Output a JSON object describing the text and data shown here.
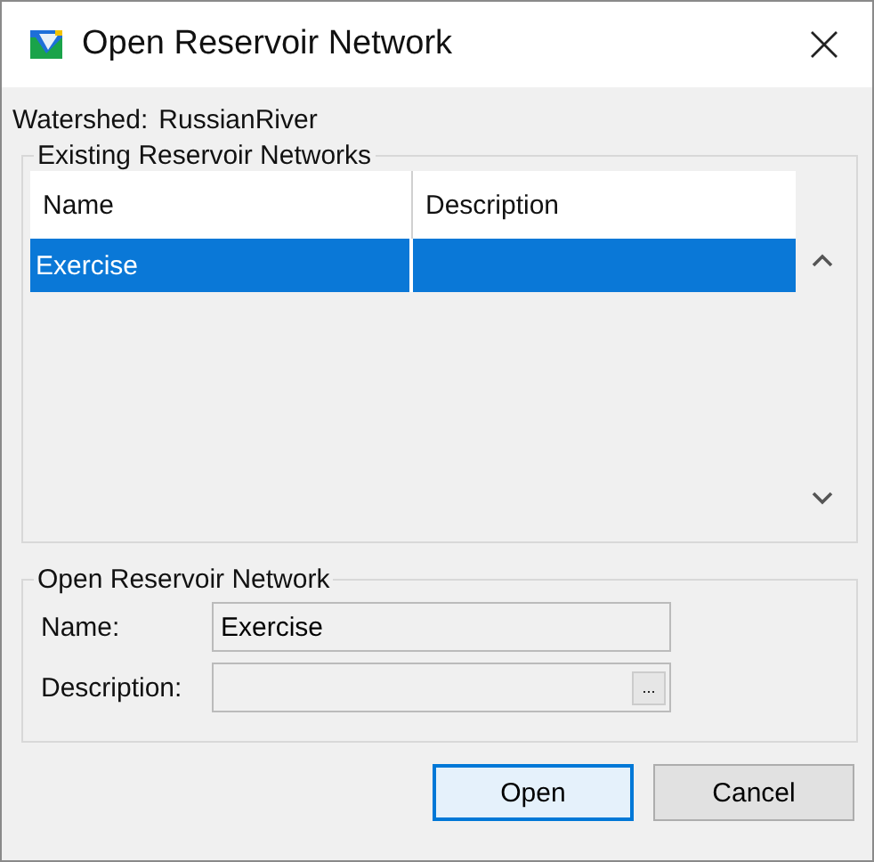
{
  "window": {
    "title": "Open Reservoir Network"
  },
  "watershed": {
    "label": "Watershed:",
    "value": "RussianRiver"
  },
  "networks": {
    "title": "Existing Reservoir Networks",
    "columns": [
      "Name",
      "Description"
    ],
    "rows": [
      {
        "name": "Exercise",
        "description": "",
        "selected": true
      }
    ]
  },
  "open_group": {
    "title": "Open Reservoir Network",
    "name_label": "Name:",
    "name_value": "Exercise",
    "description_label": "Description:",
    "browse": "..."
  },
  "buttons": [
    {
      "label": "Open",
      "default": true
    },
    {
      "label": "Cancel",
      "default": false
    }
  ]
}
